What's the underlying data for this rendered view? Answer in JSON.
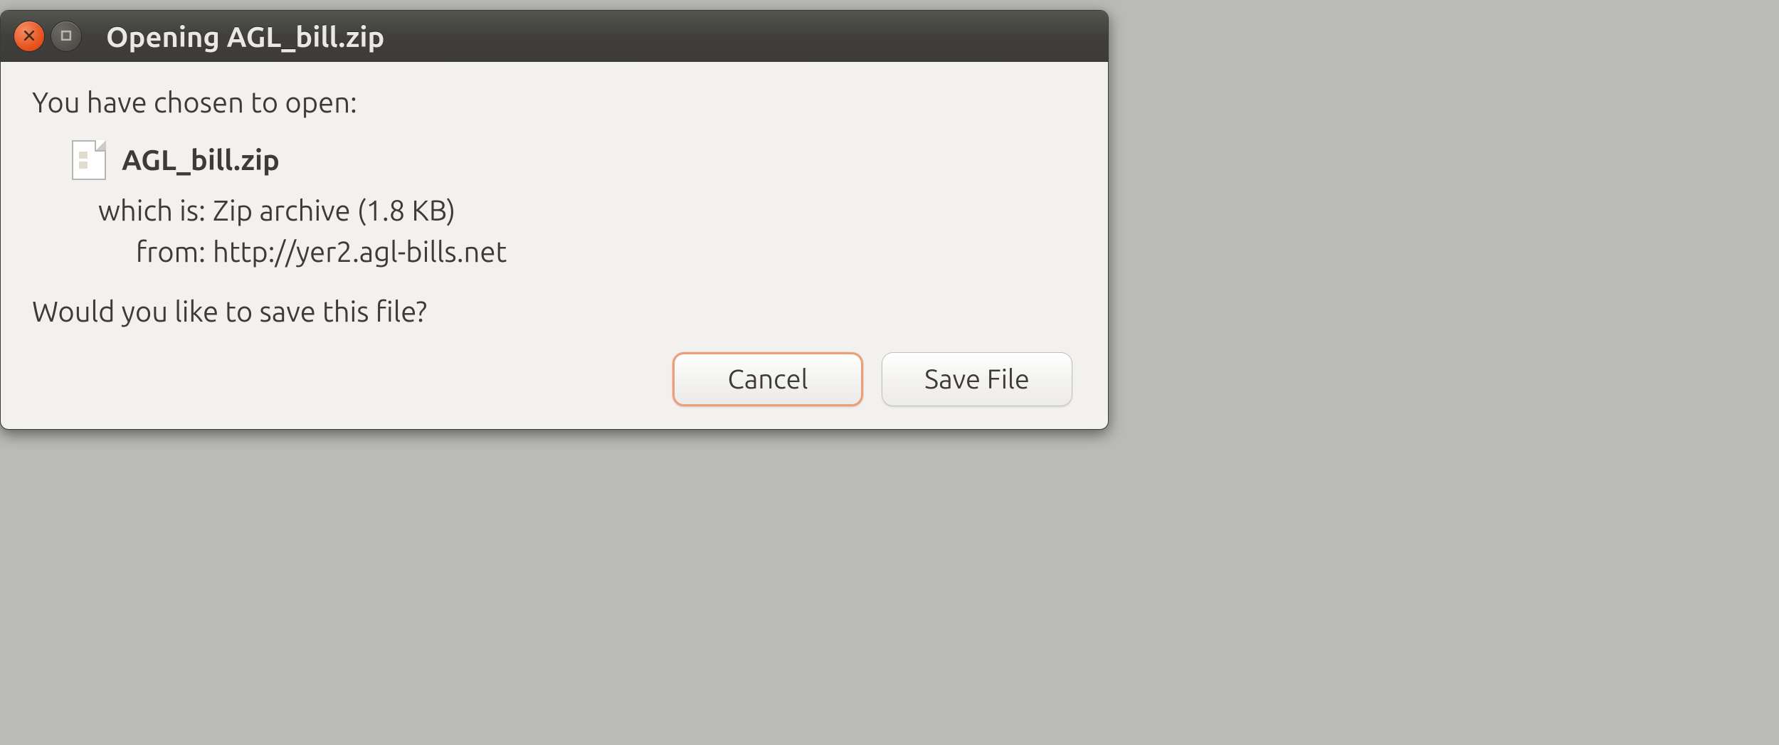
{
  "window": {
    "title": "Opening AGL_bill.zip"
  },
  "content": {
    "intro": "You have chosen to open:",
    "file_name": "AGL_bill.zip",
    "which_is_label": "which is:",
    "file_type": "Zip archive (1.8 KB)",
    "from_label": "from:",
    "from_value": "http://yer2.agl-bills.net",
    "prompt": "Would you like to save this file?"
  },
  "buttons": {
    "cancel": "Cancel",
    "save": "Save File"
  }
}
